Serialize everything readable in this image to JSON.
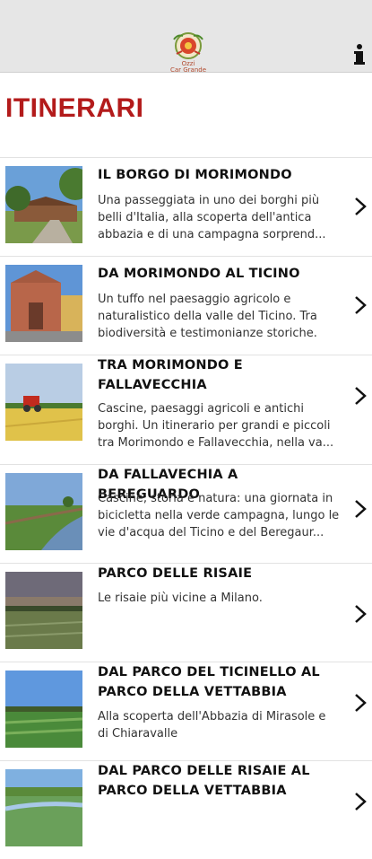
{
  "header": {
    "logo_text_line1": "Ozzi",
    "logo_text_line2": "Car Grande",
    "info_icon": "info-icon"
  },
  "page": {
    "title": "ITINERARI"
  },
  "items": [
    {
      "title": "IL BORGO DI MORIMONDO",
      "description": "Una passeggiata in uno dei borghi più belli d'Italia, alla scoperta dell'antica abbazia e di una campagna sorprend..."
    },
    {
      "title": "DA MORIMONDO AL TICINO",
      "description": "Un tuffo nel paesaggio agricolo e naturalistico della valle del Ticino. Tra biodiversità e testimonianze storiche."
    },
    {
      "title": "TRA MORIMONDO E FALLAVECCHIA",
      "description": "Cascine, paesaggi agricoli e antichi borghi. Un itinerario per grandi e piccoli tra Morimondo e Fallavecchia, nella va..."
    },
    {
      "title": "DA FALLAVECHIA A BEREGUARDO",
      "description": "Cascine, storia e natura: una giornata in bicicletta nella verde campagna, lungo le vie d'acqua del Ticino e del Beregaur..."
    },
    {
      "title": "PARCO DELLE RISAIE",
      "description": "Le risaie più vicine a Milano."
    },
    {
      "title": "DAL PARCO DEL TICINELLO AL PARCO DELLA VETTABBIA",
      "description": "Alla scoperta dell'Abbazia di Mirasole e di Chiaravalle"
    },
    {
      "title": "DAL PARCO DELLE RISAIE AL PARCO DELLA VETTABBIA",
      "description": ""
    }
  ],
  "chevron_icon": "chevron-right-icon"
}
